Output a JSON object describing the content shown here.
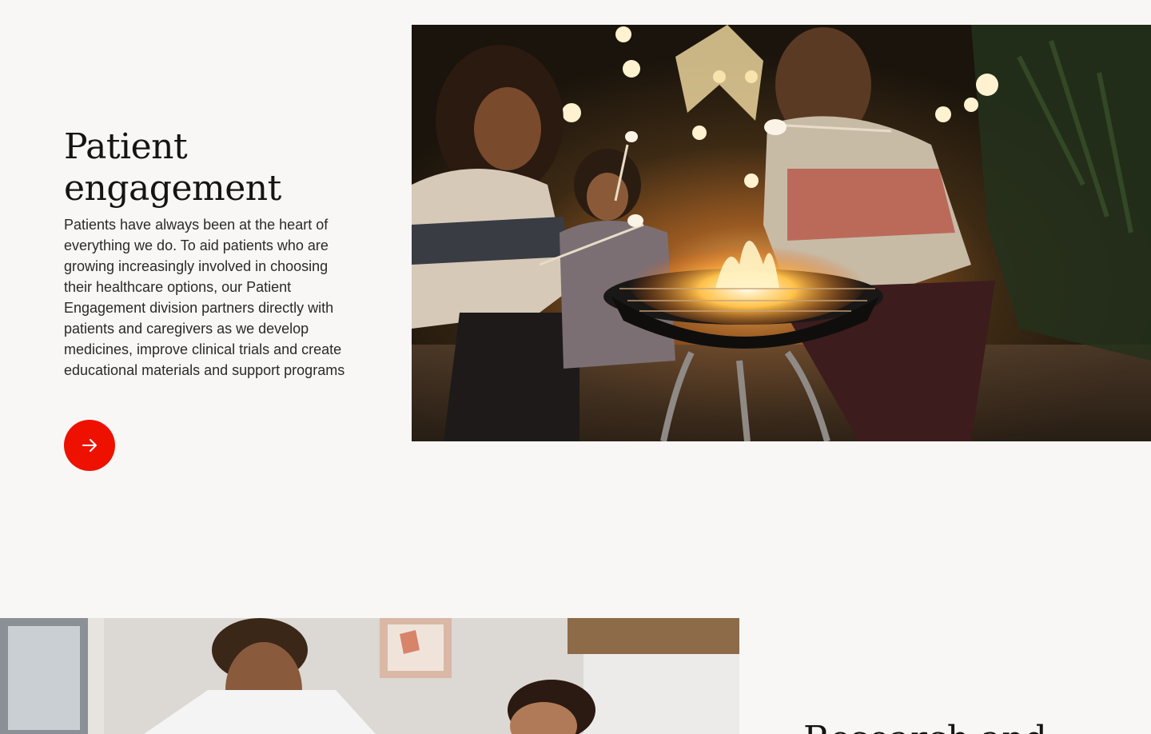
{
  "patient_engagement": {
    "title_line1": "Patient",
    "title_line2": "engagement",
    "description": "Patients have always been at the heart of everything we do. To aid patients who are growing increasingly involved in choosing their healthcare options, our Patient Engagement division partners directly with patients and caregivers as we develop medicines, improve clinical trials and create educational materials and support programs",
    "cta_icon": "arrow-right-icon",
    "image_subject": "family-roasting-marshmallows-photo"
  },
  "next_section": {
    "image_subject": "doctor-and-patient-photo",
    "title_partial": "Research and"
  },
  "colors": {
    "background": "#f8f7f5",
    "accent": "#ee1100",
    "text": "#141414"
  }
}
